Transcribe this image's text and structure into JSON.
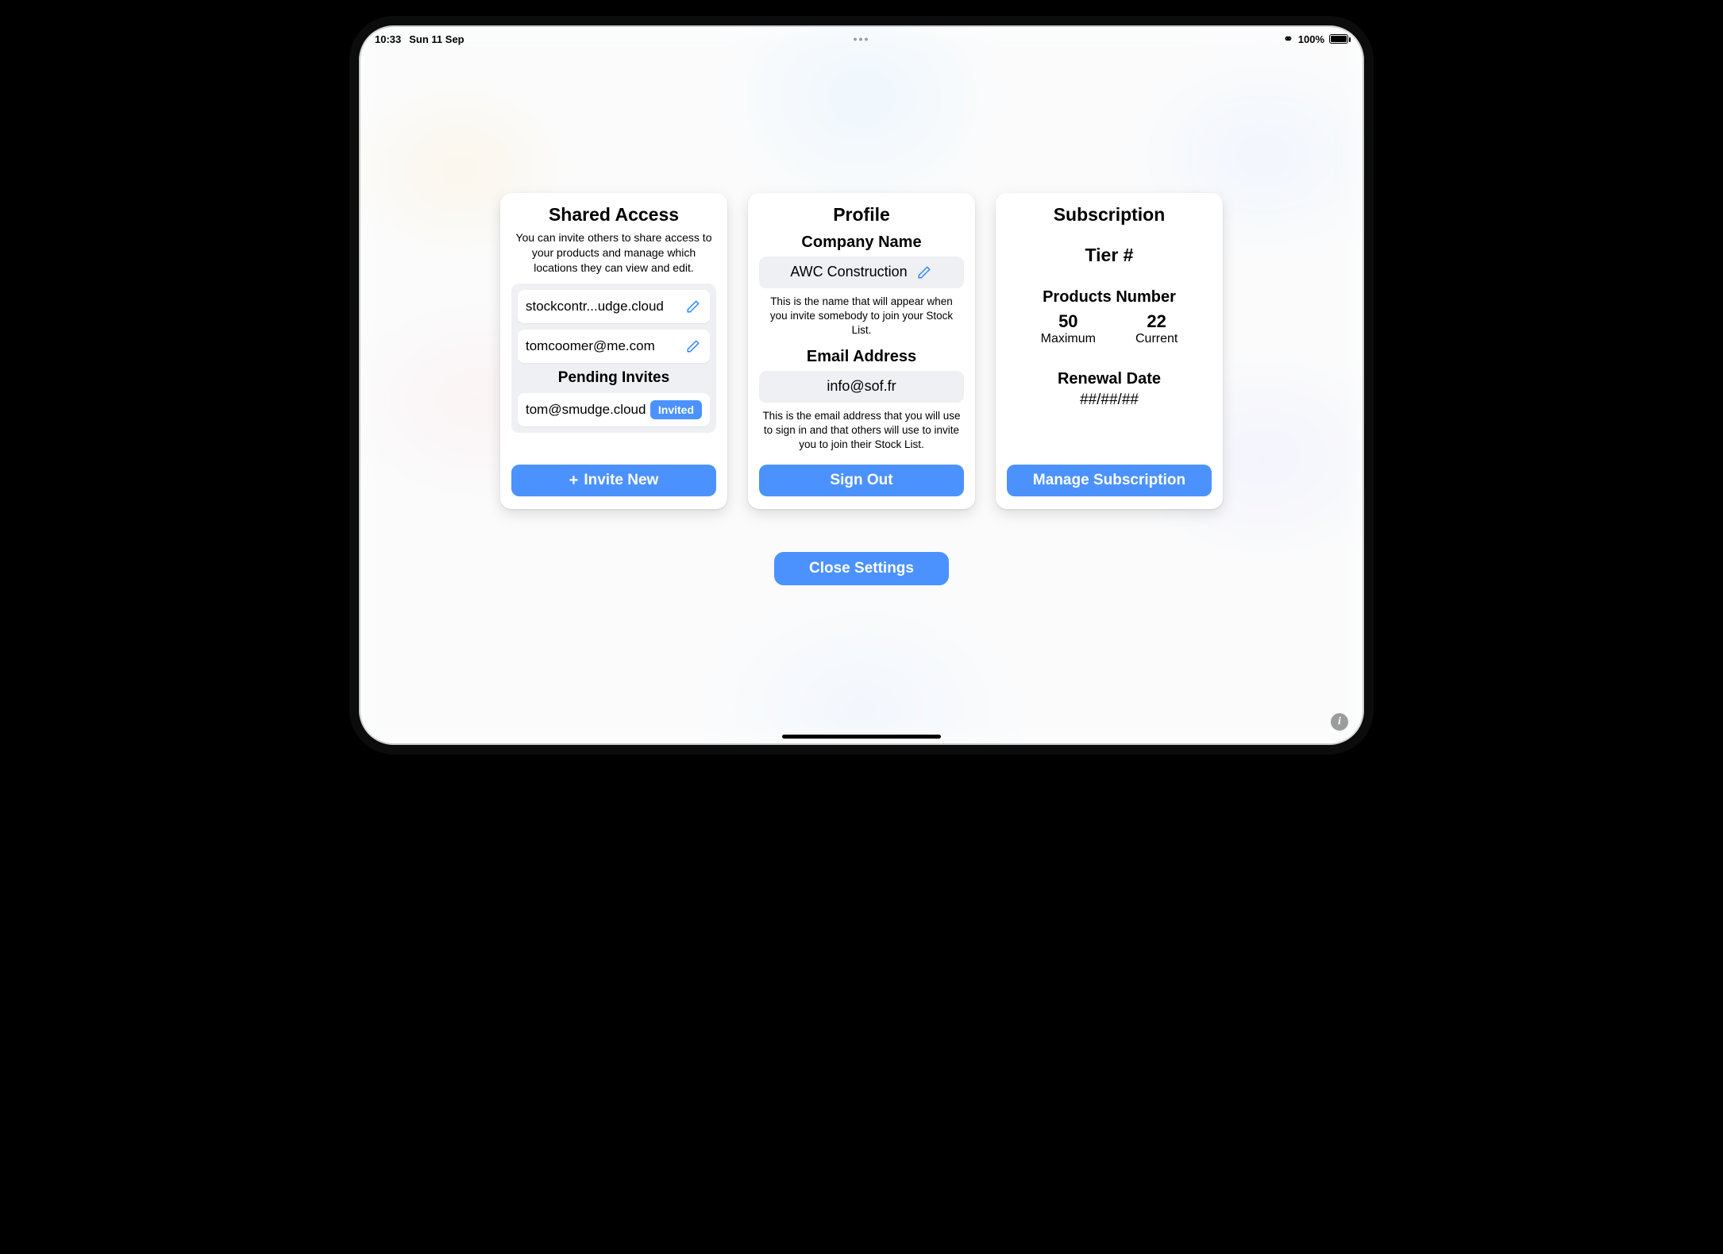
{
  "status_bar": {
    "time": "10:33",
    "date": "Sun 11 Sep",
    "dots": "•••",
    "battery_percent": "100%",
    "link_glyph": "⚭"
  },
  "shared_access": {
    "title": "Shared Access",
    "desc": "You can invite others to share access to your products and manage which locations they can view and edit.",
    "members": [
      {
        "email": "stockcontr...udge.cloud"
      },
      {
        "email": "tomcoomer@me.com"
      }
    ],
    "pending_title": "Pending Invites",
    "pending": [
      {
        "email": "tom@smudge.cloud",
        "status": "Invited"
      }
    ],
    "invite_button": "Invite New"
  },
  "profile": {
    "title": "Profile",
    "company_label": "Company Name",
    "company_value": "AWC Construction",
    "company_hint": "This is the name that will appear when you invite somebody to join your Stock List.",
    "email_label": "Email Address",
    "email_value": "info@sof.fr",
    "email_hint": "This is the email address that you will use to sign in and that others will use to invite you to join their Stock List.",
    "signout_button": "Sign Out"
  },
  "subscription": {
    "title": "Subscription",
    "tier": "Tier #",
    "products_label": "Products Number",
    "max_value": "50",
    "max_label": "Maximum",
    "cur_value": "22",
    "cur_label": "Current",
    "renewal_label": "Renewal Date",
    "renewal_value": "##/##/##",
    "manage_button": "Manage Subscription"
  },
  "close_button": "Close Settings",
  "colors": {
    "accent": "#4b92ff"
  }
}
